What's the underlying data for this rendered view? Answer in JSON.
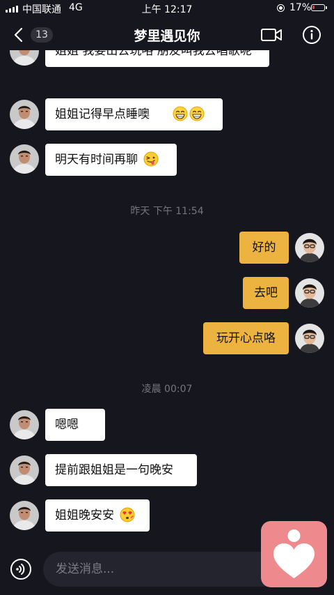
{
  "status_bar": {
    "carrier": "中国联通",
    "network": "4G",
    "time": "上午 12:17",
    "battery": "17%",
    "battery_level": 0.17,
    "battery_color": "#e8333c"
  },
  "nav": {
    "back_icon": "chevron-left-icon",
    "unread_count": "13",
    "title": "梦里遇见你",
    "video_icon": "video-camera-icon",
    "info_icon": "info-icon"
  },
  "messages": [
    {
      "side": "in",
      "text": "姐姐 我要出去玩咯 朋友叫我去唱歌呢"
    },
    {
      "side": "in",
      "text": "姐姐记得早点睡噢",
      "emoji": [
        "grin-icon",
        "grin-icon"
      ]
    },
    {
      "side": "in",
      "text": "明天有时间再聊",
      "emoji": [
        "wink-tongue-icon"
      ]
    },
    {
      "type": "time",
      "text": "昨天 下午 11:54"
    },
    {
      "side": "out",
      "text": "好的"
    },
    {
      "side": "out",
      "text": "去吧"
    },
    {
      "side": "out",
      "text": "玩开心点咯"
    },
    {
      "type": "time",
      "text": "凌晨 00:07"
    },
    {
      "side": "in",
      "text": "嗯嗯"
    },
    {
      "side": "in",
      "text": "提前跟姐姐是一句晚安"
    },
    {
      "side": "in",
      "text": "姐姐晚安安",
      "emoji": [
        "heart-eyes-icon"
      ]
    }
  ],
  "input": {
    "placeholder": "发送消息...",
    "voice_icon": "voice-icon",
    "value": ""
  },
  "floating_app": {
    "icon": "heart-person-icon",
    "color": "#ee8a8e"
  },
  "colors": {
    "background": "#16161f",
    "incoming_bubble": "#ffffff",
    "outgoing_bubble": "#edb341",
    "timestamp": "#75757d"
  }
}
